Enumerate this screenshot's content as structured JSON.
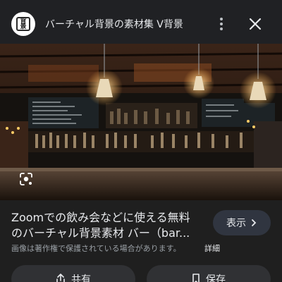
{
  "header": {
    "favicon_text": "背景",
    "site_title": "バーチャル背景の素材集 V背景"
  },
  "result": {
    "caption_line1": "Zoomでの飲み会などに使える無料",
    "caption_line2": "のバーチャル背景素材 バー（bar...",
    "visit_label": "表示",
    "copyright_notice": "画像は著作権で保護されている場合があります。",
    "details_label": "詳細"
  },
  "actions": {
    "share_label": "共有",
    "save_label": "保存"
  }
}
